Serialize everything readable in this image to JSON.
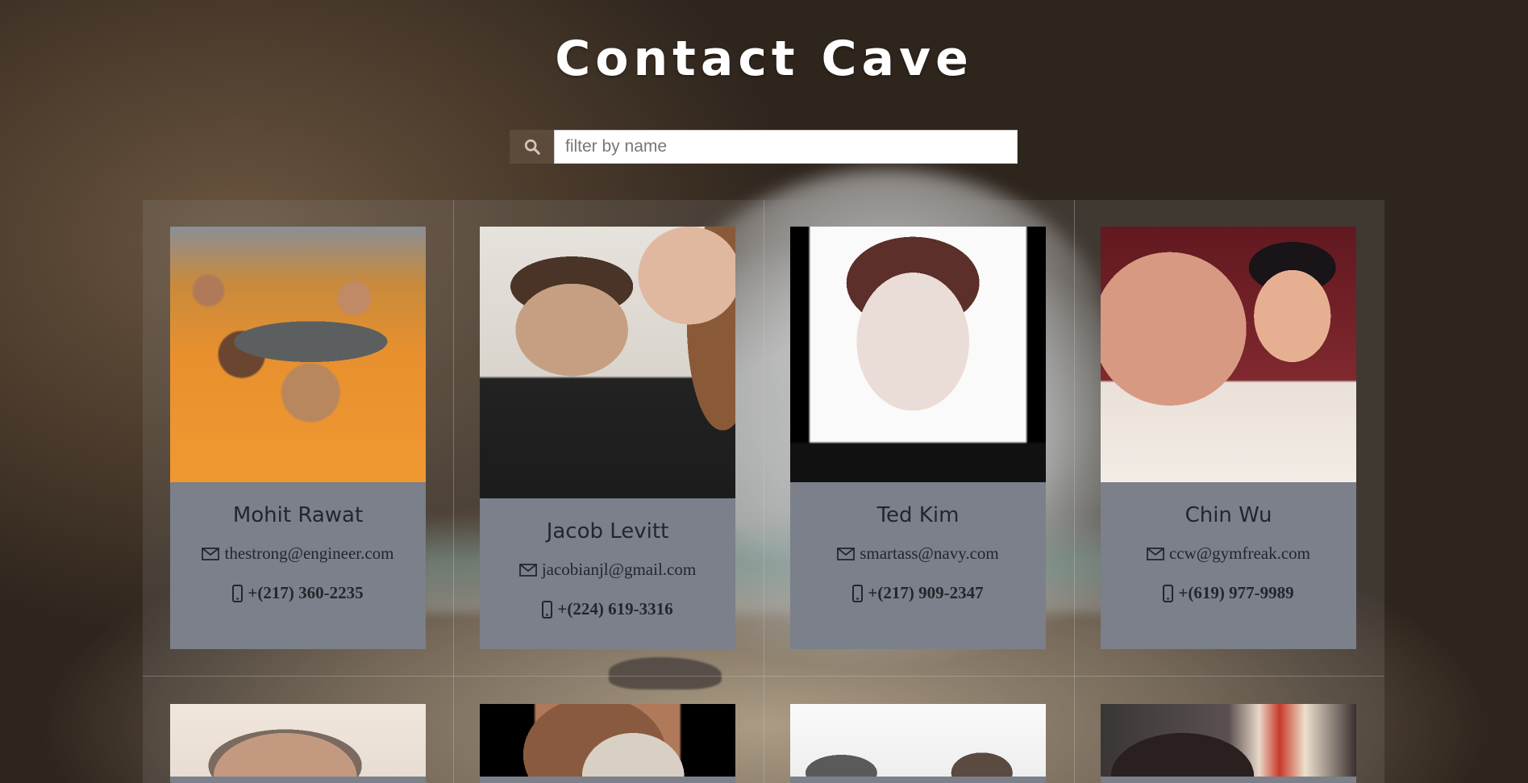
{
  "app": {
    "title": "Contact Cave"
  },
  "search": {
    "placeholder": "filter by name",
    "value": "",
    "icon": "search-icon"
  },
  "colors": {
    "card_bg": "#7b808a",
    "search_addon_bg": "#5c4a3b",
    "text_dark": "#23272b"
  },
  "contacts": [
    {
      "name": "Mohit Rawat",
      "email": "thestrong@engineer.com",
      "phone": "+(217) 360-2235"
    },
    {
      "name": "Jacob Levitt",
      "email": "jacobianjl@gmail.com",
      "phone": "+(224) 619-3316"
    },
    {
      "name": "Ted Kim",
      "email": "smartass@navy.com",
      "phone": "+(217) 909-2347"
    },
    {
      "name": "Chin Wu",
      "email": "ccw@gymfreak.com",
      "phone": "+(619) 977-9989"
    }
  ]
}
